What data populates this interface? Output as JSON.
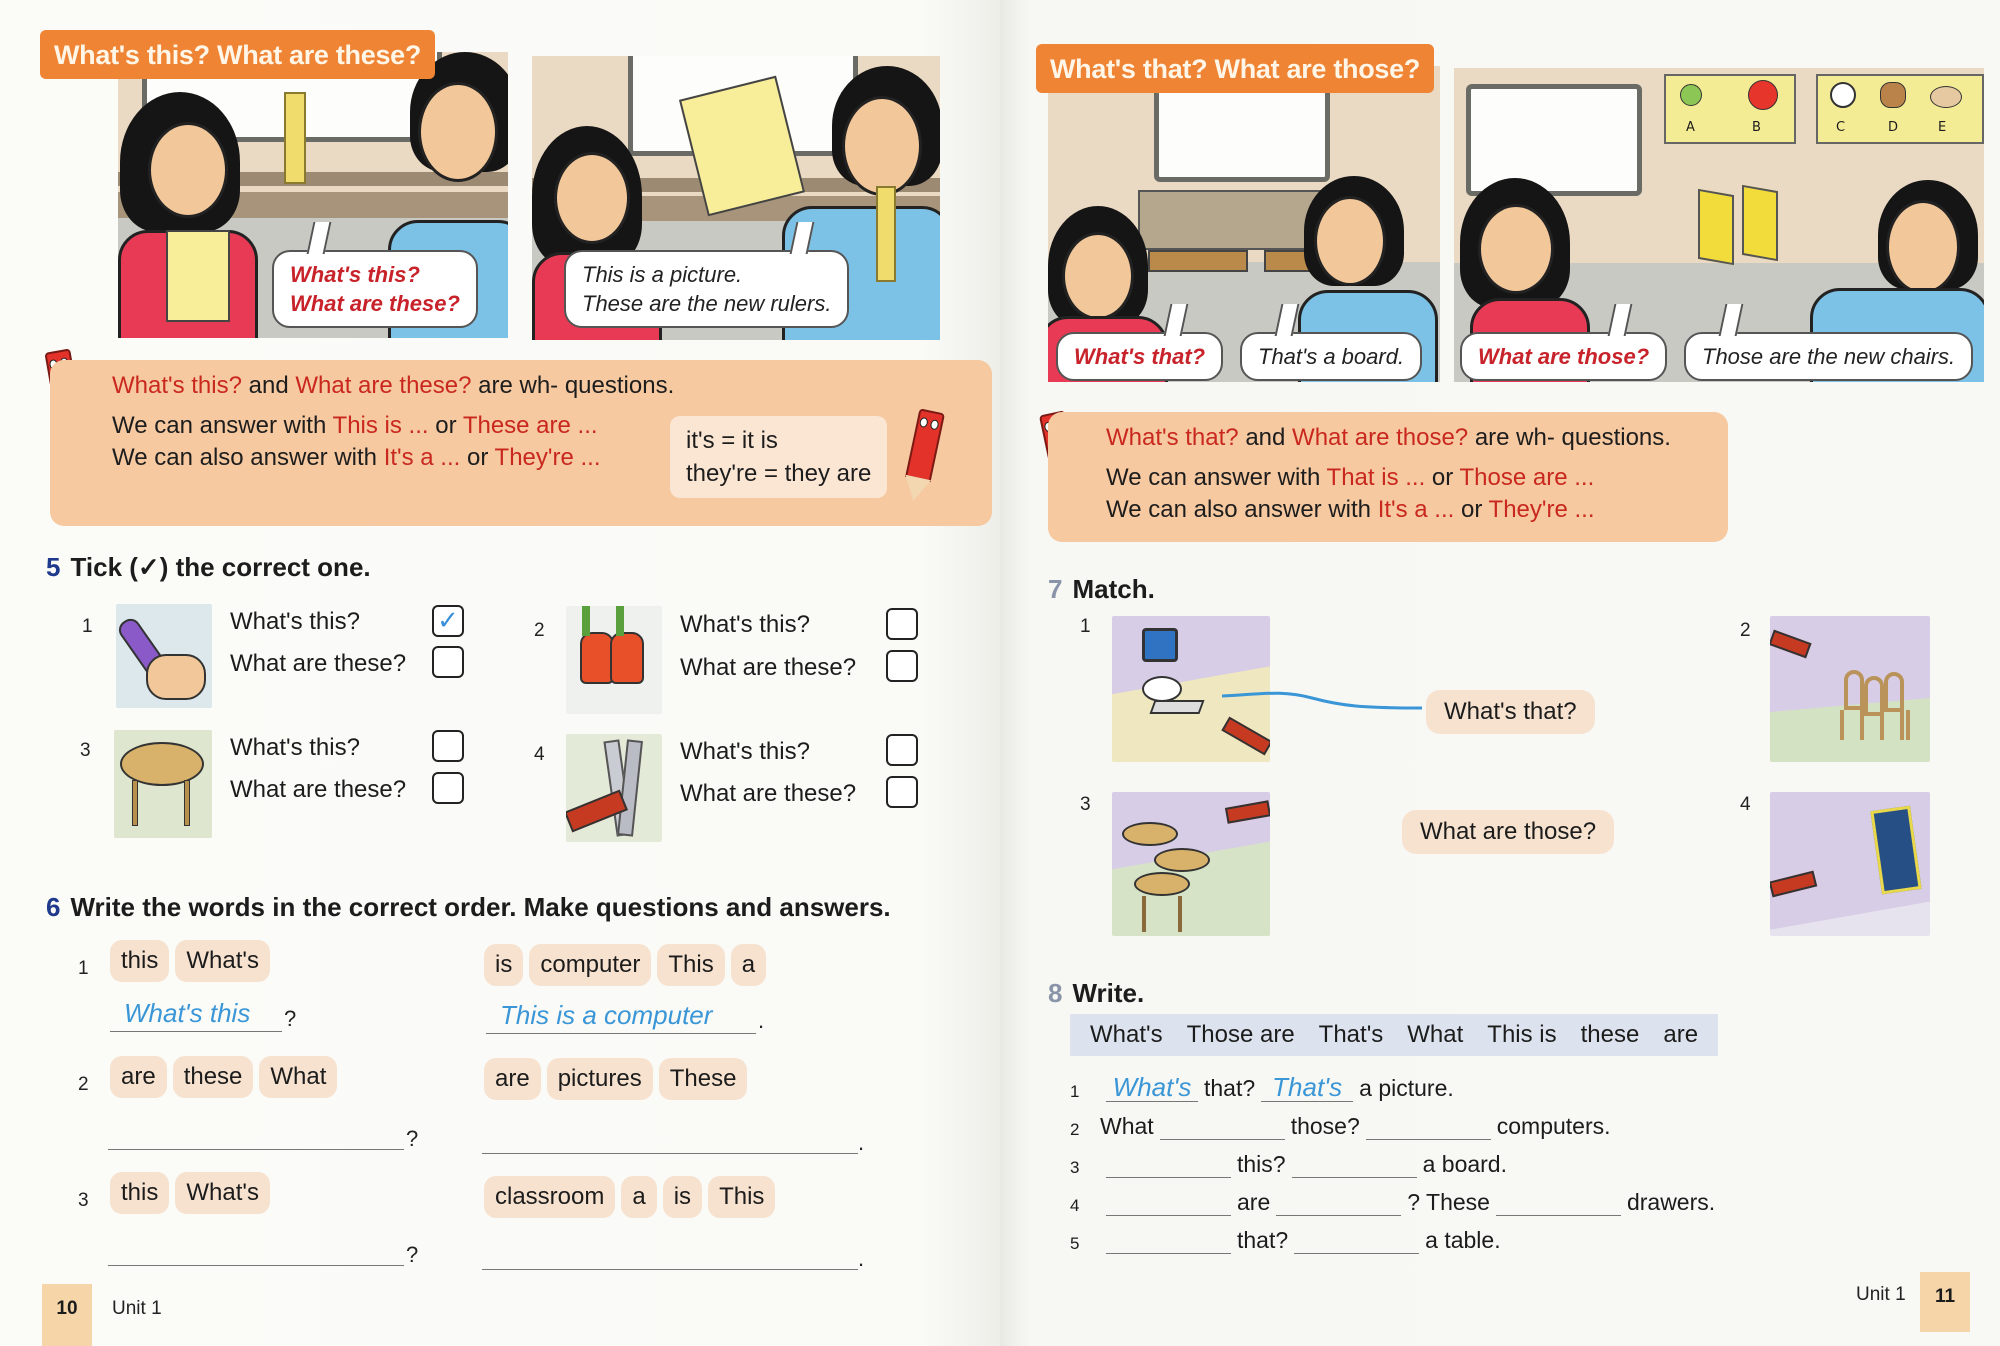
{
  "left_page": {
    "banner_title": "What's this? What are these?",
    "comic": {
      "panel1_bubble": [
        "What's this?",
        "What are these?"
      ],
      "panel2_bubble": [
        "This is a picture.",
        "These are the new rulers."
      ]
    },
    "grammar": {
      "line1": {
        "q1": "What's this?",
        "and": " and ",
        "q2": "What are these?",
        "rest": " are wh- questions."
      },
      "line2": {
        "pre": "We can answer with ",
        "a1": "This is ...",
        "or": " or ",
        "a2": "These are ..."
      },
      "line3": {
        "pre": "We can also answer with ",
        "a1": "It's a ...",
        "or": " or ",
        "a2": "They're ..."
      },
      "note": [
        "it's = it is",
        "they're = they are"
      ]
    },
    "exercise5": {
      "number": "5",
      "title": "Tick (✓) the correct one.",
      "items": [
        {
          "num": "1",
          "image": "marker-pen",
          "options": [
            {
              "label": "What's this?",
              "checked": true
            },
            {
              "label": "What are these?",
              "checked": false
            }
          ]
        },
        {
          "num": "2",
          "image": "two-chairs",
          "options": [
            {
              "label": "What's this?",
              "checked": false
            },
            {
              "label": "What are these?",
              "checked": false
            }
          ]
        },
        {
          "num": "3",
          "image": "stool",
          "options": [
            {
              "label": "What's this?",
              "checked": false
            },
            {
              "label": "What are these?",
              "checked": false
            }
          ]
        },
        {
          "num": "4",
          "image": "rulers",
          "options": [
            {
              "label": "What's this?",
              "checked": false
            },
            {
              "label": "What are these?",
              "checked": false
            }
          ]
        }
      ],
      "check_mark": "✓"
    },
    "exercise6": {
      "number": "6",
      "title": "Write the words in the correct order. Make questions and answers.",
      "items": [
        {
          "num": "1",
          "question_words": [
            "this",
            "What's"
          ],
          "answer_words": [
            "is",
            "computer",
            "This",
            "a"
          ],
          "question_answer": "What's this",
          "answer_answer": "This is a computer"
        },
        {
          "num": "2",
          "question_words": [
            "are",
            "these",
            "What"
          ],
          "answer_words": [
            "are",
            "pictures",
            "These"
          ],
          "question_answer": "",
          "answer_answer": ""
        },
        {
          "num": "3",
          "question_words": [
            "this",
            "What's"
          ],
          "answer_words": [
            "classroom",
            "a",
            "is",
            "This"
          ],
          "question_answer": "",
          "answer_answer": ""
        }
      ],
      "q_punct": "?",
      "a_punct": "."
    },
    "footer": {
      "page_number": "10",
      "unit": "Unit 1"
    }
  },
  "right_page": {
    "banner_title": "What's that? What are those?",
    "comic": {
      "panel1_q": "What's that?",
      "panel1_a": "That's a board.",
      "panel2_q": "What are those?",
      "panel2_a": "Those are the new chairs.",
      "poster_letters": [
        "A",
        "B",
        "C",
        "D",
        "E"
      ]
    },
    "grammar": {
      "line1": {
        "q1": "What's that?",
        "and": " and ",
        "q2": "What are those?",
        "rest": " are wh- questions."
      },
      "line2": {
        "pre": "We can answer with ",
        "a1": "That is ...",
        "or": " or ",
        "a2": "Those are ..."
      },
      "line3": {
        "pre": "We can also answer with ",
        "a1": "It's a ...",
        "or": " or ",
        "a2": "They're ..."
      }
    },
    "exercise7": {
      "number": "7",
      "title": "Match.",
      "pictures": [
        {
          "num": "1",
          "image": "computer"
        },
        {
          "num": "2",
          "image": "chairs"
        },
        {
          "num": "3",
          "image": "stools"
        },
        {
          "num": "4",
          "image": "poster"
        }
      ],
      "phrases": [
        "What's that?",
        "What are those?"
      ],
      "line_color": "#3a96d6"
    },
    "exercise8": {
      "number": "8",
      "title": "Write.",
      "word_bank": [
        "What's",
        "Those are",
        "That's",
        "What",
        "This is",
        "these",
        "are"
      ],
      "sentences": [
        {
          "num": "1",
          "parts": [
            {
              "blank": "What's"
            },
            {
              "text": "that?"
            },
            {
              "blank": "That's"
            },
            {
              "text": "a picture."
            }
          ]
        },
        {
          "num": "2",
          "parts": [
            {
              "text": "What"
            },
            {
              "blank": ""
            },
            {
              "text": "those?"
            },
            {
              "blank": ""
            },
            {
              "text": "computers."
            }
          ]
        },
        {
          "num": "3",
          "parts": [
            {
              "blank": ""
            },
            {
              "text": "this?"
            },
            {
              "blank": ""
            },
            {
              "text": "a board."
            }
          ]
        },
        {
          "num": "4",
          "parts": [
            {
              "blank": ""
            },
            {
              "text": "are"
            },
            {
              "blank": ""
            },
            {
              "text": "? These"
            },
            {
              "blank": ""
            },
            {
              "text": "drawers."
            }
          ]
        },
        {
          "num": "5",
          "parts": [
            {
              "blank": ""
            },
            {
              "text": "that?"
            },
            {
              "blank": ""
            },
            {
              "text": "a table."
            }
          ]
        }
      ]
    },
    "footer": {
      "page_number": "11",
      "unit": "Unit 1"
    }
  },
  "colors": {
    "banner": "#ee8434",
    "grammar_box": "#f6c9a0",
    "highlight_red": "#c9281e",
    "answer_blue": "#3a96d6",
    "exercise_number_blue": "#1f3a8c",
    "word_chip": "#f6e2cf",
    "word_bank": "#dde3ee",
    "page_number_box": "#f6d5a8"
  }
}
